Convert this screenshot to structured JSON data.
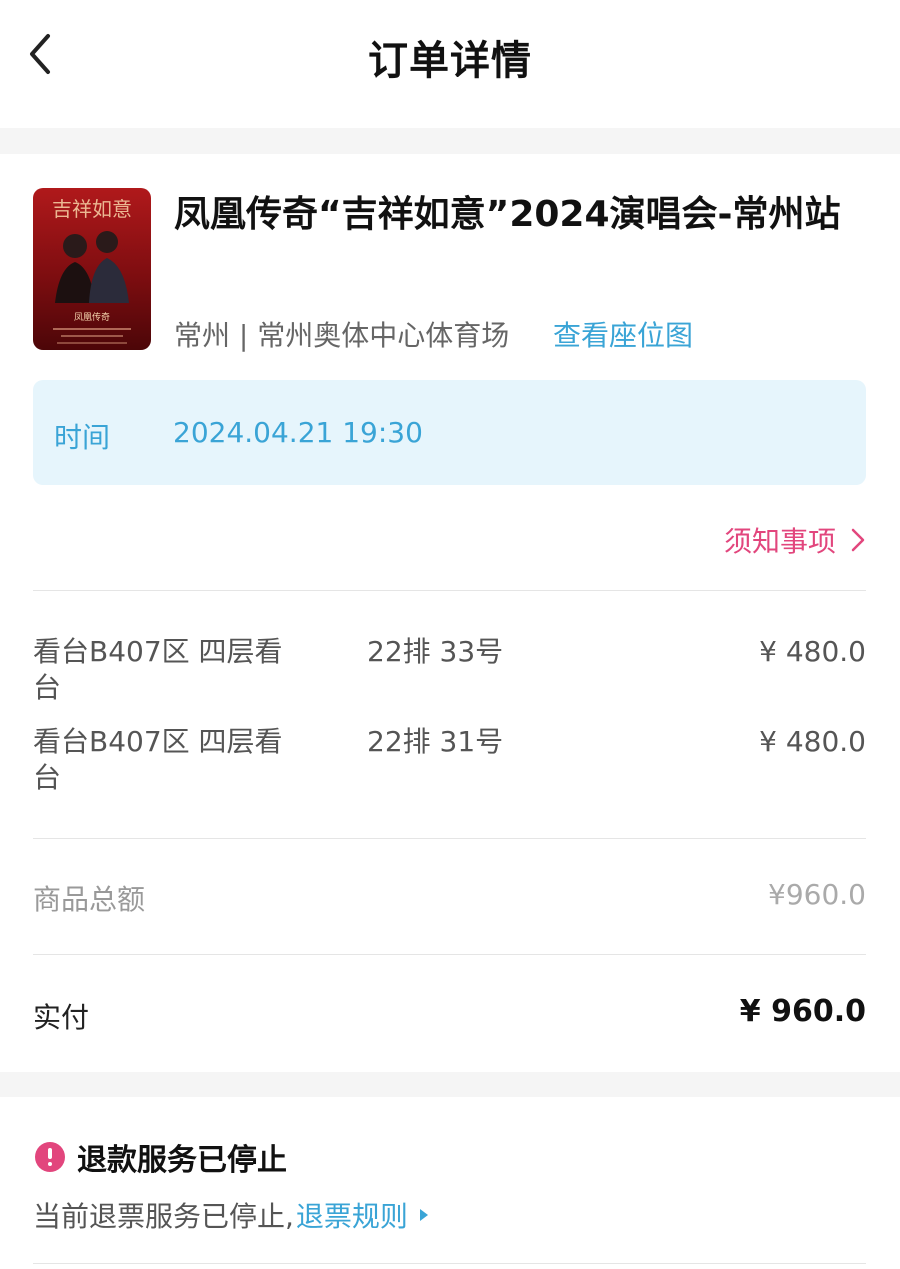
{
  "header": {
    "title": "订单详情",
    "back_icon": "chevron-left-icon"
  },
  "event": {
    "title": "凤凰传奇“吉祥如意”2024演唱会-常州站",
    "venue": "常州 | 常州奥体中心体育场",
    "seat_map_link": "查看座位图",
    "poster_title": "吉祥如意",
    "poster_artist": "凤凰传奇"
  },
  "schedule": {
    "label": "时间",
    "value": "2024.04.21 19:30"
  },
  "notice_link": "须知事项",
  "tickets": [
    {
      "area": "看台B407区 四层看台",
      "seat": "22排 33号",
      "price": "¥ 480.0"
    },
    {
      "area": "看台B407区 四层看台",
      "seat": "22排 31号",
      "price": "¥ 480.0"
    }
  ],
  "summary": {
    "subtotal_label": "商品总额",
    "subtotal_value": "¥960.0",
    "paid_label": "实付",
    "paid_value": "¥ 960.0"
  },
  "refund": {
    "title": "退款服务已停止",
    "description": "当前退票服务已停止,",
    "rules_link": "退票规则",
    "icon": "alert-circle-icon"
  },
  "colors": {
    "accent_blue": "#3aa4d6",
    "accent_pink": "#e2467d",
    "time_box_bg": "#e6f5fc"
  }
}
